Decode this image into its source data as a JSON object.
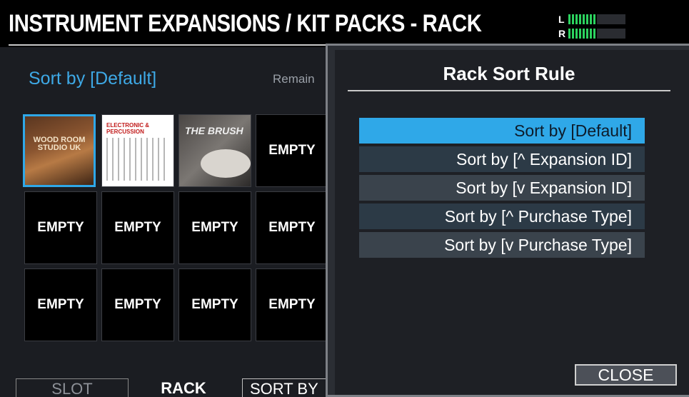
{
  "header": {
    "title": "INSTRUMENT EXPANSIONS / KIT PACKS - RACK",
    "meter_left_label": "L",
    "meter_right_label": "R"
  },
  "rack": {
    "sort_label": "Sort by [Default]",
    "remain_label": "Remain",
    "slots": [
      {
        "label": "WOOD ROOM STUDIO UK",
        "kind": "expansion-art"
      },
      {
        "label": "ELECTRONIC & PERCUSSION",
        "kind": "expansion-art"
      },
      {
        "label": "THE BRUSH",
        "kind": "expansion-art"
      },
      {
        "label": "EMPTY",
        "kind": "empty"
      },
      {
        "label": "EMPTY",
        "kind": "empty"
      },
      {
        "label": "EMPTY",
        "kind": "empty"
      },
      {
        "label": "EMPTY",
        "kind": "empty"
      },
      {
        "label": "EMPTY",
        "kind": "empty"
      },
      {
        "label": "EMPTY",
        "kind": "empty"
      },
      {
        "label": "EMPTY",
        "kind": "empty"
      },
      {
        "label": "EMPTY",
        "kind": "empty"
      },
      {
        "label": "EMPTY",
        "kind": "empty"
      }
    ]
  },
  "bottom_tabs": {
    "slot": "SLOT",
    "rack": "RACK",
    "sort_by": "SORT BY"
  },
  "dialog": {
    "title": "Rack Sort Rule",
    "options": [
      "Sort by [Default]",
      "Sort by [^ Expansion ID]",
      "Sort by [v Expansion ID]",
      "Sort by [^ Purchase Type]",
      "Sort by [v Purchase Type]"
    ],
    "selected_index": 0,
    "close_label": "CLOSE"
  },
  "colors": {
    "accent": "#2fa8e8",
    "meter_green": "#2cd35f"
  }
}
